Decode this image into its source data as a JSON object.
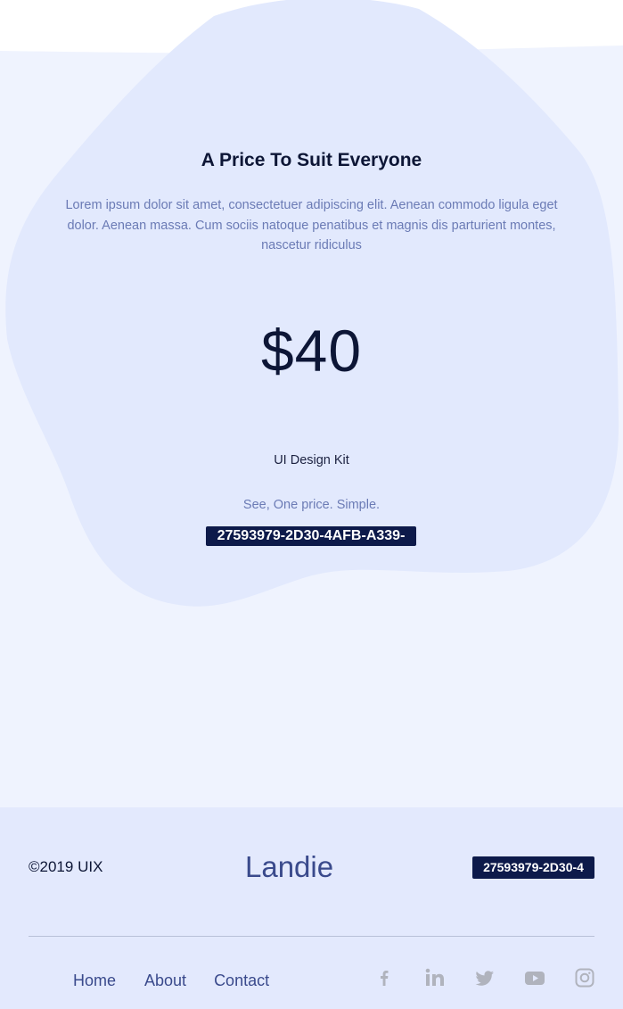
{
  "pricing": {
    "title": "A Price To Suit Everyone",
    "description": "Lorem ipsum dolor sit amet, consectetuer adipiscing elit. Aenean commodo ligula eget dolor. Aenean massa. Cum sociis natoque penatibus et magnis dis parturient montes, nascetur ridiculus",
    "price": "$40",
    "product": "UI Design Kit",
    "tagline": "See, One price. Simple.",
    "code": "27593979-2D30-4AFB-A339-"
  },
  "footer": {
    "copyright": "©2019 UIX",
    "logo": "Landie",
    "code": "27593979-2D30-4",
    "nav": [
      {
        "label": "Home"
      },
      {
        "label": "About"
      },
      {
        "label": "Contact"
      }
    ],
    "socials": [
      {
        "icon": "facebook-icon"
      },
      {
        "icon": "linkedin-icon"
      },
      {
        "icon": "twitter-icon"
      },
      {
        "icon": "youtube-icon"
      },
      {
        "icon": "instagram-icon"
      }
    ]
  },
  "colors": {
    "page_bg": "#eff3fe",
    "blob": "#e2e9fd",
    "footer_bg": "#e3e9fd",
    "heading": "#0d1636",
    "body_text": "#6b7bb5",
    "badge_bg": "#0d1a4a",
    "social_icon": "#b0b3bd"
  }
}
